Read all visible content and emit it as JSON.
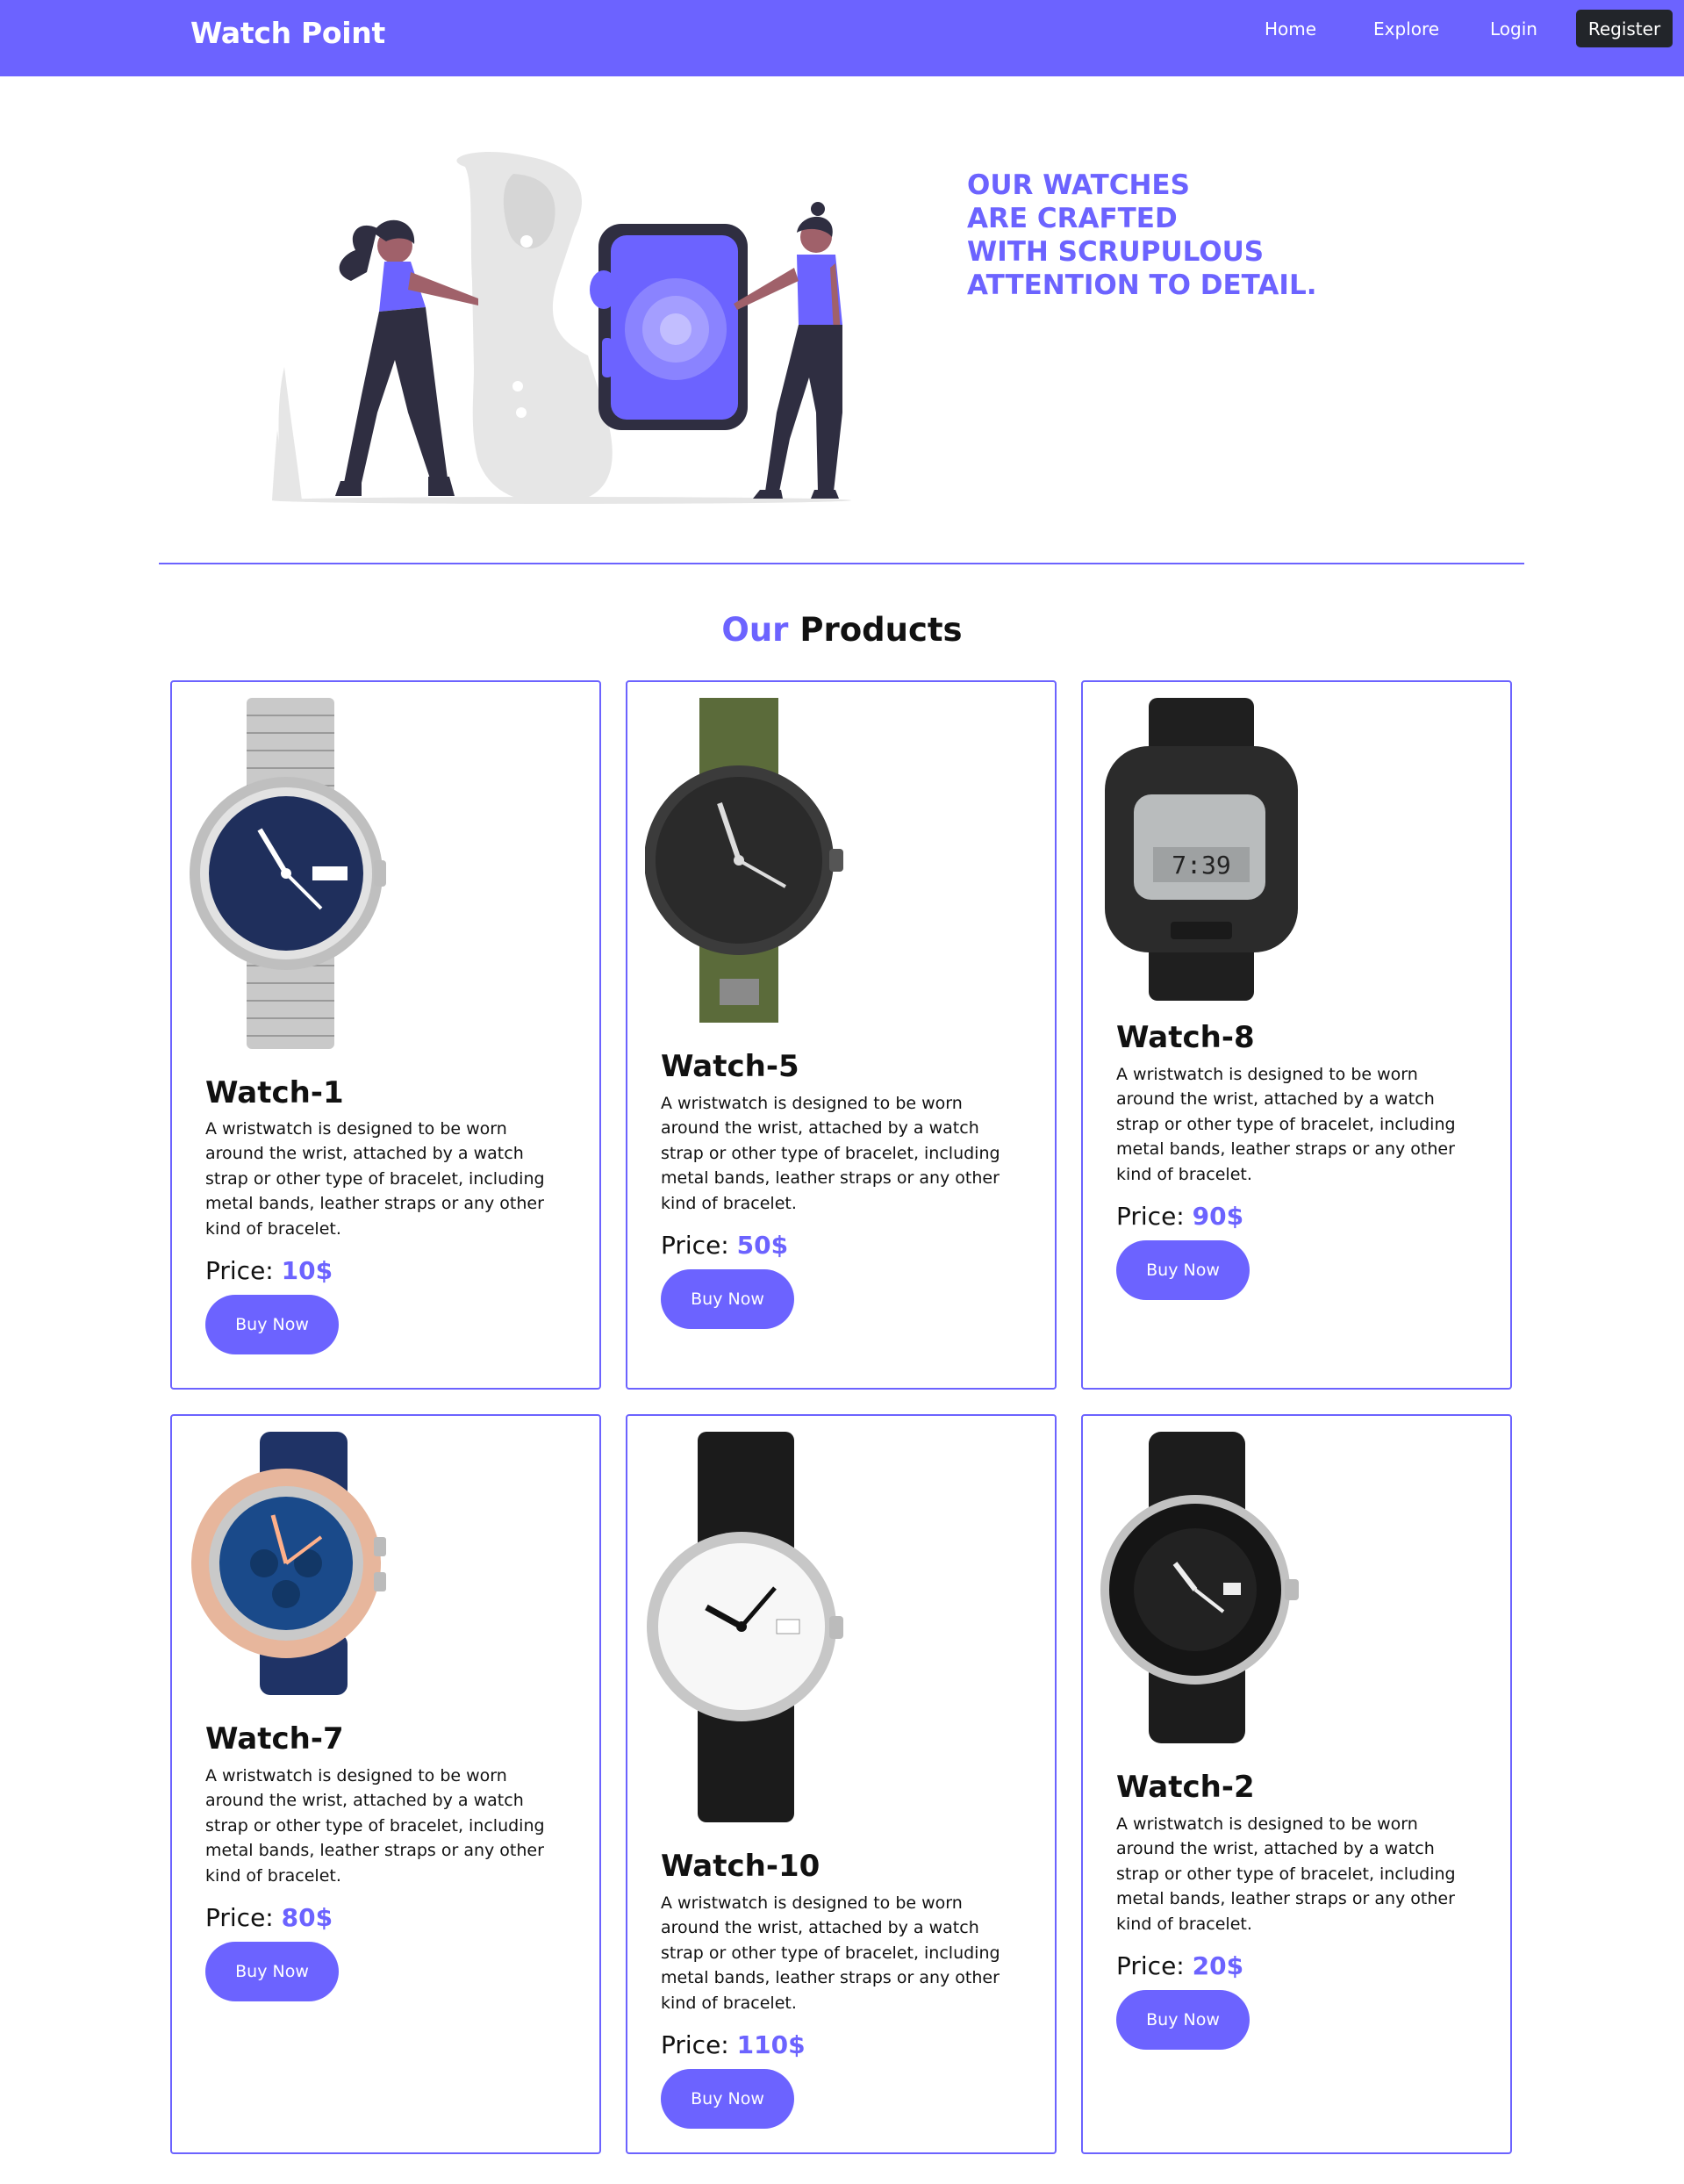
{
  "navbar": {
    "brand": "Watch Point",
    "links": [
      "Home",
      "Explore",
      "Login"
    ],
    "register_label": "Register",
    "bg_color": "#6c63ff"
  },
  "hero": {
    "tagline_lines": [
      "OUR WATCHES",
      "ARE CRAFTED",
      "WITH SCRUPULOUS",
      "ATTENTION TO DETAIL."
    ],
    "illustration": "people-with-smartwatch-illustration"
  },
  "products_section": {
    "title_accent": "Our",
    "title_rest": "Products"
  },
  "colors": {
    "accent": "#6c63ff",
    "dark": "#22252a",
    "text": "#111111"
  },
  "products": [
    {
      "name": "Watch-1",
      "description": "A wristwatch is designed to be worn around the wrist, attached by a watch strap or other type of bracelet, including metal bands, leather straps or any other kind of bracelet.",
      "price_label": "Price:",
      "price": "10$",
      "button": "Buy Now",
      "image": "steel-bracelet-blue-dial-watch"
    },
    {
      "name": "Watch-5",
      "description": "A wristwatch is designed to be worn around the wrist, attached by a watch strap or other type of bracelet, including metal bands, leather straps or any other kind of bracelet.",
      "price_label": "Price:",
      "price": "50$",
      "button": "Buy Now",
      "image": "green-nato-strap-field-watch"
    },
    {
      "name": "Watch-8",
      "description": "A wristwatch is designed to be worn around the wrist, attached by a watch strap or other type of bracelet, including metal bands, leather straps or any other kind of bracelet.",
      "price_label": "Price:",
      "price": "90$",
      "button": "Buy Now",
      "image": "black-digital-sport-watch"
    },
    {
      "name": "Watch-7",
      "description": "A wristwatch is designed to be worn around the wrist, attached by a watch strap or other type of bracelet, including metal bands, leather straps or any other kind of bracelet.",
      "price_label": "Price:",
      "price": "80$",
      "button": "Buy Now",
      "image": "blue-rubber-chronograph-watch"
    },
    {
      "name": "Watch-10",
      "description": "A wristwatch is designed to be worn around the wrist, attached by a watch strap or other type of bracelet, including metal bands, leather straps or any other kind of bracelet.",
      "price_label": "Price:",
      "price": "110$",
      "button": "Buy Now",
      "image": "black-leather-white-dial-watch"
    },
    {
      "name": "Watch-2",
      "description": "A wristwatch is designed to be worn around the wrist, attached by a watch strap or other type of bracelet, including metal bands, leather straps or any other kind of bracelet.",
      "price_label": "Price:",
      "price": "20$",
      "button": "Buy Now",
      "image": "black-diver-watch"
    }
  ]
}
